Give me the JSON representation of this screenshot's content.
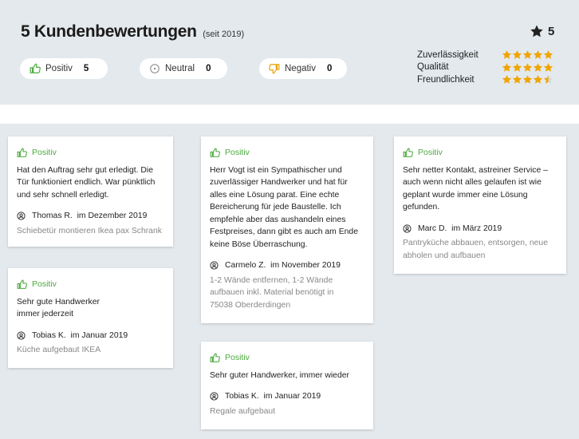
{
  "header": {
    "title": "5 Kundenbewertungen",
    "since": "(seit 2019)",
    "overall_rating": "5",
    "filters": [
      {
        "label": "Positiv",
        "count": "5"
      },
      {
        "label": "Neutral",
        "count": "0"
      },
      {
        "label": "Negativ",
        "count": "0"
      }
    ],
    "ratings": [
      {
        "label": "Zuverlässigkeit",
        "stars": 5
      },
      {
        "label": "Qualität",
        "stars": 5
      },
      {
        "label": "Freundlichkeit",
        "stars": 4.5
      }
    ]
  },
  "colors": {
    "positive": "#4caa3e",
    "star": "#f0a500",
    "negative": "#e8a200"
  },
  "reviews": [
    {
      "tag": "Positiv",
      "text": "Hat den Auftrag sehr gut erledigt. Die Tür funktioniert endlich. War pünktlich und sehr schnell erledigt.",
      "author": "Thomas R.",
      "date": "im Dezember 2019",
      "job": "Schiebetür montieren Ikea pax Schrank"
    },
    {
      "tag": "Positiv",
      "text": "Sehr gute Handwerker immer jederzeit",
      "author": "Tobias K.",
      "date": "im Januar 2019",
      "job": "Küche aufgebaut IKEA"
    },
    {
      "tag": "Positiv",
      "text": "Herr Vogt ist ein Sympathischer und zuverlässiger Handwerker und hat für alles eine Lösung parat. Eine echte Bereicherung für jede Baustelle. Ich empfehle aber das aushandeln eines Festpreises, dann gibt es auch am Ende keine Böse Überraschung.",
      "author": "Carmelo Z.",
      "date": "im November 2019",
      "job": "1-2 Wände entfernen, 1-2 Wände aufbauen inkl. Material benötigt in 75038 Oberderdingen"
    },
    {
      "tag": "Positiv",
      "text": "Sehr guter Handwerker, immer wieder",
      "author": "Tobias K.",
      "date": "im Januar 2019",
      "job": "Regale aufgebaut"
    },
    {
      "tag": "Positiv",
      "text": "Sehr netter Kontakt, astreiner Service – auch wenn nicht alles gelaufen ist wie geplant wurde immer eine Lösung gefunden.",
      "author": "Marc D.",
      "date": "im März 2019",
      "job": "Pantryküche abbauen, entsorgen, neue abholen und aufbauen"
    }
  ]
}
